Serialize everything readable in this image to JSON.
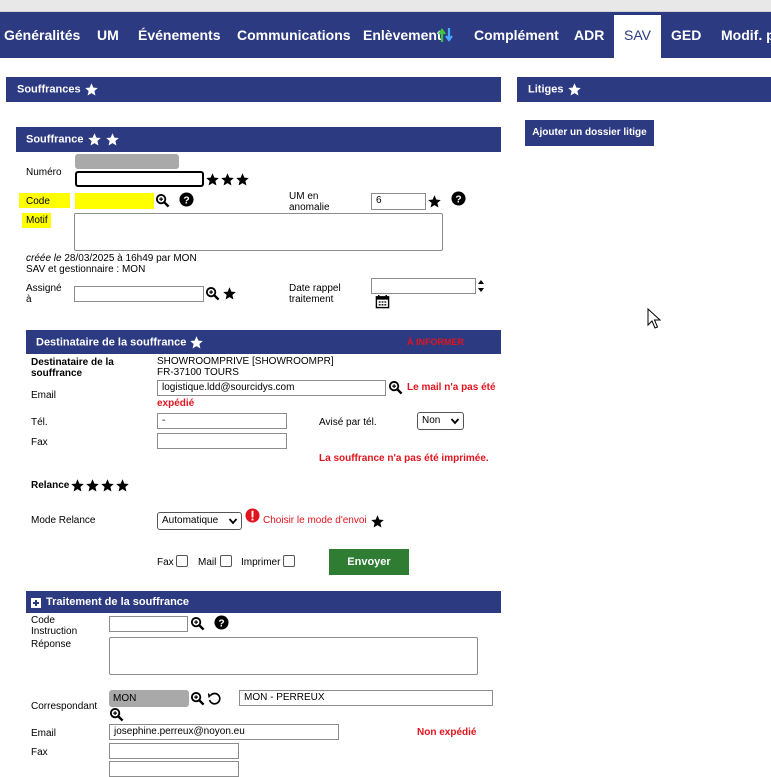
{
  "tabs": [
    {
      "label": "Généralités"
    },
    {
      "label": "UM"
    },
    {
      "label": "Événements"
    },
    {
      "label": "Communications"
    },
    {
      "label": "Enlèvement"
    },
    {
      "label": "Complément"
    },
    {
      "label": "ADR"
    },
    {
      "label": "SAV"
    },
    {
      "label": "GED"
    },
    {
      "label": "Modif. p"
    }
  ],
  "active_tab": "SAV",
  "souffrances_header": "Souffrances",
  "litiges": {
    "header": "Litiges",
    "add_button": "Ajouter un dossier litige"
  },
  "souffrance": {
    "header": "Souffrance",
    "numero_label": "Numéro",
    "code_label": "Code",
    "motif_label": "Motif",
    "um_label_1": "UM en",
    "um_label_2": "anomalie",
    "um_value": "6",
    "created_prefix": "créée le",
    "created_text": "28/03/2025 à 16h49 par MON",
    "manager_text": "SAV et gestionnaire : MON",
    "assigne_label_1": "Assigné",
    "assigne_label_2": "à",
    "date_rappel_1": "Date rappel",
    "date_rappel_2": "traitement"
  },
  "destinataire": {
    "header": "Destinataire de la souffrance",
    "status": "À INFORMER",
    "dest_label_1": "Destinataire de la",
    "dest_label_2": "souffrance",
    "dest_value_1": "SHOWROOMPRIVE [SHOWROOMPR]",
    "dest_value_2": "FR-37100 TOURS",
    "email_label": "Email",
    "email_value": "logistique.ldd@sourcidys.com",
    "mail_msg_1": "Le mail n'a pas été",
    "mail_msg_2": "expédié",
    "tel_label": "Tél.",
    "tel_value": "-",
    "avise_label": "Avisé par tél.",
    "avise_value": "Non",
    "fax_label": "Fax",
    "print_msg": "La souffrance n'a pas été imprimée.",
    "relance_label": "Relance",
    "mode_relance_label": "Mode Relance",
    "mode_relance_value": "Automatique",
    "choose_mode": "Choisir le mode d'envoi",
    "fax_chk": "Fax",
    "mail_chk": "Mail",
    "print_chk": "Imprimer",
    "send_button": "Envoyer"
  },
  "traitement": {
    "header": "Traitement de la souffrance",
    "code_label_1": "Code",
    "code_label_2": "Instruction",
    "reponse_label": "Réponse",
    "correspondant_label": "Correspondant",
    "correspondant_code": "MON",
    "correspondant_name": "MON - PERREUX",
    "email_label": "Email",
    "email_value": "josephine.perreux@noyon.eu",
    "email_status": "Non expédié",
    "fax_label": "Fax"
  },
  "colors": {
    "nav": "#2c3a82",
    "send_button": "#2e7d32",
    "error": "#e0141e",
    "highlight": "#ffff00"
  }
}
